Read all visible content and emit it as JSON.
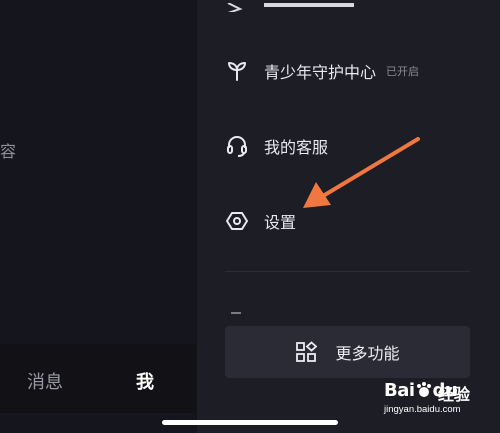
{
  "left_pane": {
    "partial_text": "容",
    "tabbar": {
      "messages": "消息",
      "me": "我"
    }
  },
  "drawer": {
    "items": [
      {
        "label": "青少年守护中心",
        "badge": "已开启",
        "icon": "sprout-icon"
      },
      {
        "label": "我的客服",
        "icon": "headset-icon"
      },
      {
        "label": "设置",
        "icon": "hexagon-settings-icon"
      }
    ],
    "more_button": {
      "label": "更多功能",
      "icon": "grid-icon"
    }
  },
  "annotation": {
    "arrow_color": "#f07840"
  },
  "watermark": {
    "brand": "Bai",
    "brand2": "du",
    "product": "经验",
    "url": "jingyan.baidu.com"
  }
}
